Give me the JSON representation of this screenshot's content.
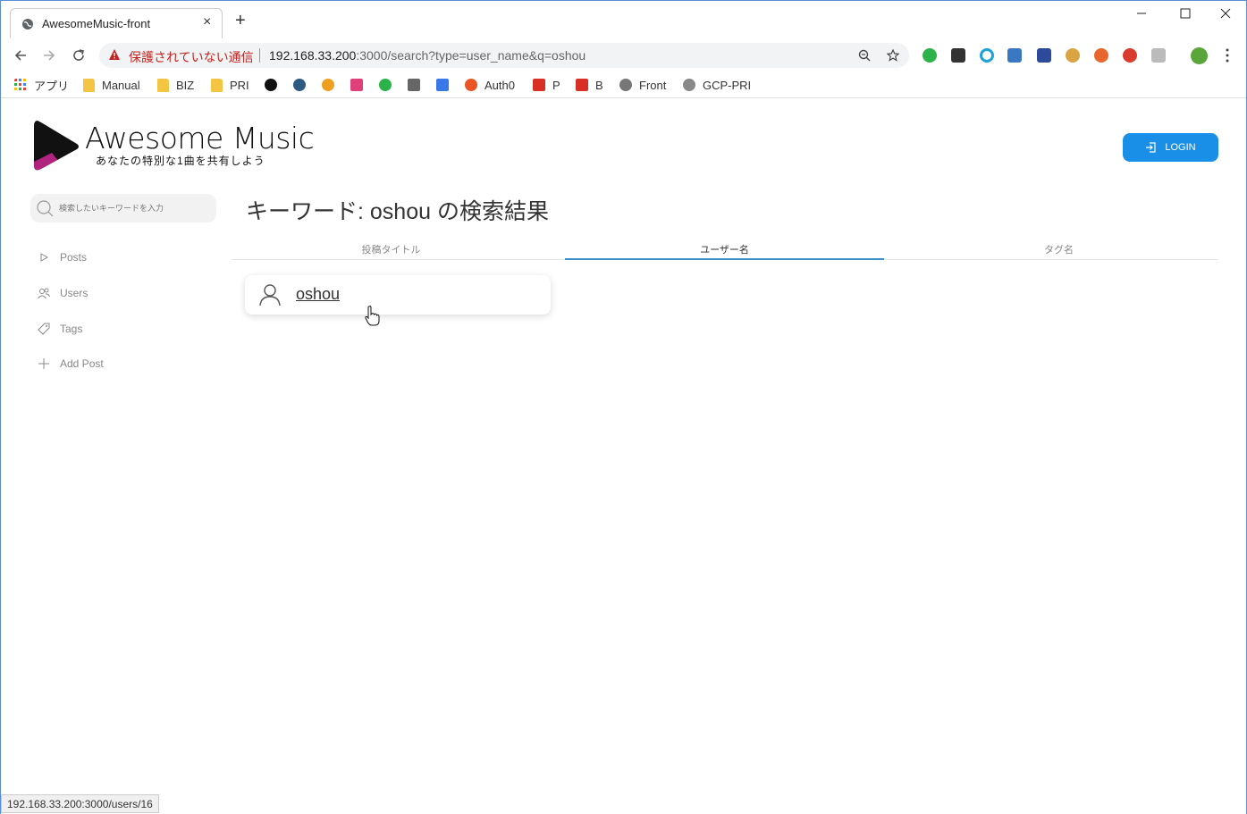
{
  "browser": {
    "tab_title": "AwesomeMusic-front",
    "tab_close": "×",
    "new_tab": "+",
    "warning_text": "保護されていない通信",
    "url_host": "192.168.33.200",
    "url_path": ":3000/search?type=user_name&q=oshou",
    "status_url": "192.168.33.200:3000/users/16",
    "bookmarks": {
      "apps": "アプリ",
      "manual": "Manual",
      "biz": "BIZ",
      "pri": "PRI",
      "auth0": "Auth0",
      "gmail_p": "P",
      "gmail_b": "B",
      "front": "Front",
      "gcp": "GCP-PRI"
    }
  },
  "site": {
    "logo_title": "Awesome Music",
    "logo_subtitle": "あなたの特別な1曲を共有しよう",
    "login_label": "LOGIN",
    "search_placeholder": "検索したいキーワードを入力",
    "sidebar": {
      "posts": "Posts",
      "users": "Users",
      "tags": "Tags",
      "add_post": "Add Post"
    },
    "heading": "キーワード: oshou の検索結果",
    "tabs": {
      "post_title": "投稿タイトル",
      "user_name": "ユーザー名",
      "tag_name": "タグ名"
    },
    "results": {
      "user_name": "oshou"
    },
    "colors": {
      "accent": "#1a8fe8",
      "tab_underline": "#3a8fc8"
    }
  }
}
